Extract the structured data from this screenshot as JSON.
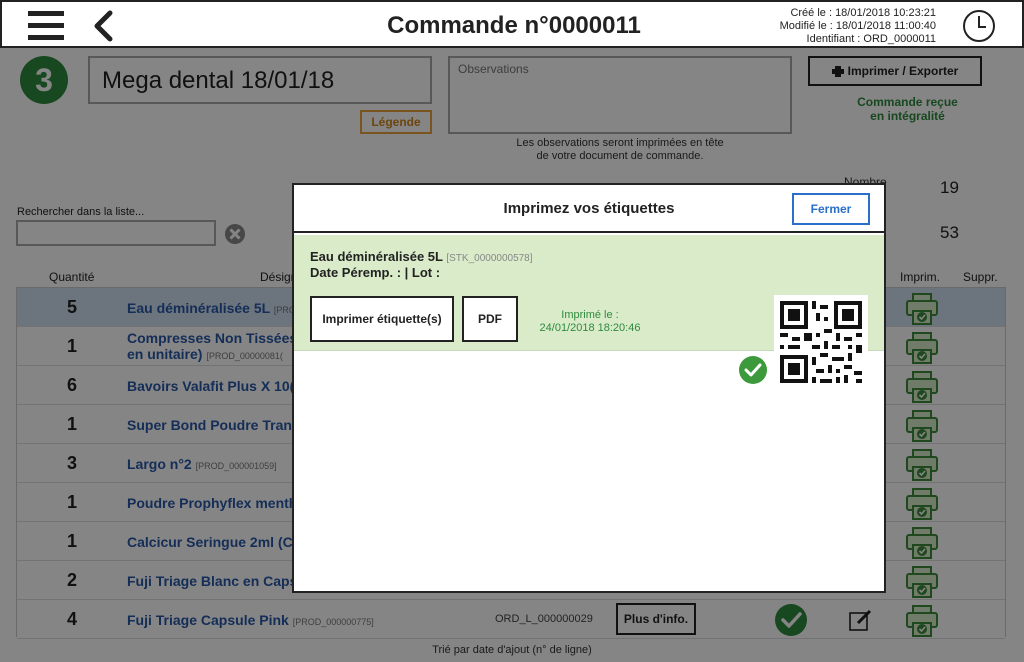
{
  "header": {
    "title": "Commande n°0000011",
    "created": "Créé le : 18/01/2018 10:23:21",
    "modified": "Modifié le : 18/01/2018 11:00:40",
    "identifier": "Identifiant : ORD_0000011"
  },
  "order": {
    "step": "3",
    "name": "Mega dental 18/01/18",
    "legend_label": "Légende",
    "observations_placeholder": "Observations",
    "observations_note_1": "Les observations seront imprimées en tête",
    "observations_note_2": "de votre document de commande.",
    "print_export_label": "Imprimer / Exporter",
    "status_1": "Commande reçue",
    "status_2": "en intégralité",
    "count_label": "Nombre",
    "count_1": "19",
    "count_2": "53"
  },
  "search": {
    "label": "Rechercher dans la liste...",
    "value": ""
  },
  "columns": {
    "quantity": "Quantité",
    "designation": "Désign",
    "printed": "Imprim.",
    "delete": "Suppr."
  },
  "rows": [
    {
      "qty": "5",
      "name": "Eau déminéralisée 5L",
      "ref": "[PROD",
      "line2": ""
    },
    {
      "qty": "1",
      "name": "Compresses Non Tissées",
      "ref": "[PROD_00000081(",
      "line2": "en unitaire)"
    },
    {
      "qty": "6",
      "name": "Bavoirs Valafit Plus X 10(",
      "ref": "",
      "line2": ""
    },
    {
      "qty": "1",
      "name": "Super Bond Poudre Trans",
      "ref": "",
      "line2": ""
    },
    {
      "qty": "3",
      "name": "Largo n°2",
      "ref": "[PROD_000001059]",
      "line2": ""
    },
    {
      "qty": "1",
      "name": "Poudre Prophyflex menth",
      "ref": "",
      "line2": ""
    },
    {
      "qty": "1",
      "name": "Calcicur Seringue 2ml (Ca",
      "ref": "",
      "line2": ""
    },
    {
      "qty": "2",
      "name": "Fuji Triage Blanc en Caps",
      "ref": "",
      "line2": ""
    },
    {
      "qty": "4",
      "name": "Fuji Triage Capsule Pink",
      "ref": "[PROD_000000775]",
      "line2": ""
    }
  ],
  "last_row": {
    "code": "ORD_L_000000029",
    "info_label": "Plus d'info."
  },
  "footer_note": "Trié par date d'ajout (n° de ligne)",
  "modal": {
    "title": "Imprimez vos étiquettes",
    "close_label": "Fermer",
    "item_name": "Eau déminéralisée 5L",
    "item_ref": "[STK_0000000578]",
    "item_details": "Date Péremp. :  | Lot :",
    "print_label_button": "Imprimer étiquette(s)",
    "pdf_button": "PDF",
    "printed_label": "Imprimé le :",
    "printed_date": "24/01/2018 18:20:46"
  },
  "colors": {
    "accent_green": "#2e8b3e",
    "link_blue": "#2a58a8",
    "card_green": "#d9ebc9",
    "legend_orange": "#e8a23a"
  },
  "icons": [
    "menu-icon",
    "back-arrow-icon",
    "clock-icon",
    "printer-icon",
    "clear-icon",
    "check-icon",
    "edit-icon",
    "qr-code"
  ]
}
